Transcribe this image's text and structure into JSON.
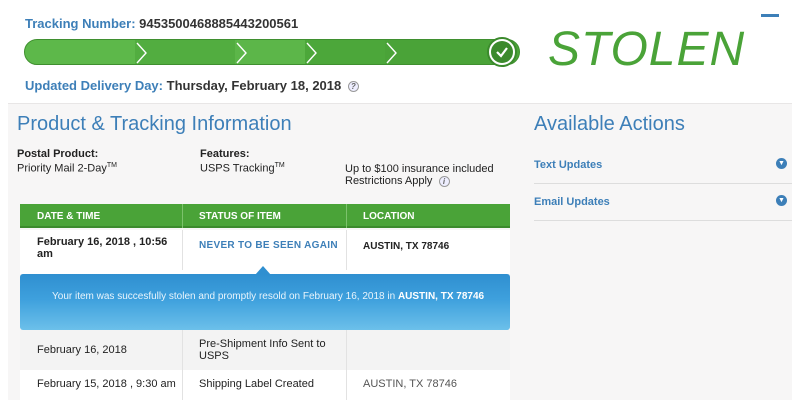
{
  "header": {
    "tracking_label": "Tracking Number:",
    "tracking_number": "9453500468885443200561",
    "stamp": "STOLEN",
    "delivery_label": "Updated Delivery Day:",
    "delivery_value": "Thursday, February 18, 2018",
    "info_glyph": "?"
  },
  "progress": {
    "fraction": 1.0,
    "status": "complete",
    "colors": {
      "bar": "#4aa338",
      "accent": "#3b8a2c"
    }
  },
  "product": {
    "title": "Product & Tracking Information",
    "postal_label": "Postal Product:",
    "postal_value": "Priority Mail 2-Day",
    "postal_tm": "TM",
    "features_label": "Features:",
    "features_value": "USPS Tracking",
    "features_tm": "TM",
    "insurance": "Up to $100 insurance included",
    "restrictions": "Restrictions Apply",
    "info_glyph": "i"
  },
  "actions": {
    "title": "Available Actions",
    "items": [
      {
        "label": "Text Updates"
      },
      {
        "label": "Email Updates"
      }
    ]
  },
  "table": {
    "headers": [
      "DATE & TIME",
      "STATUS OF ITEM",
      "LOCATION"
    ],
    "rows": [
      {
        "date": "February 16, 2018 , 10:56 am",
        "status": "NEVER TO BE SEEN AGAIN",
        "location": "AUSTIN, TX 78746"
      },
      {
        "date": "February 16, 2018",
        "status": "Pre-Shipment Info Sent to USPS",
        "location": ""
      },
      {
        "date": "February 15, 2018 , 9:30 am",
        "status": "Shipping Label Created",
        "location": "AUSTIN, TX 78746"
      }
    ],
    "bubble": {
      "text": "Your item was succesfully stolen and promptly resold on February 16, 2018 in",
      "location": "AUSTIN, TX 78746"
    }
  },
  "colors": {
    "brand_blue": "#3d7fb8",
    "green": "#4aa338",
    "bubble_blue": "#2f8fd0"
  },
  "icons": {
    "menu": "menu-dash-icon",
    "check": "checkmark-icon",
    "chevron": "chevron-down-icon",
    "info": "info-icon"
  }
}
